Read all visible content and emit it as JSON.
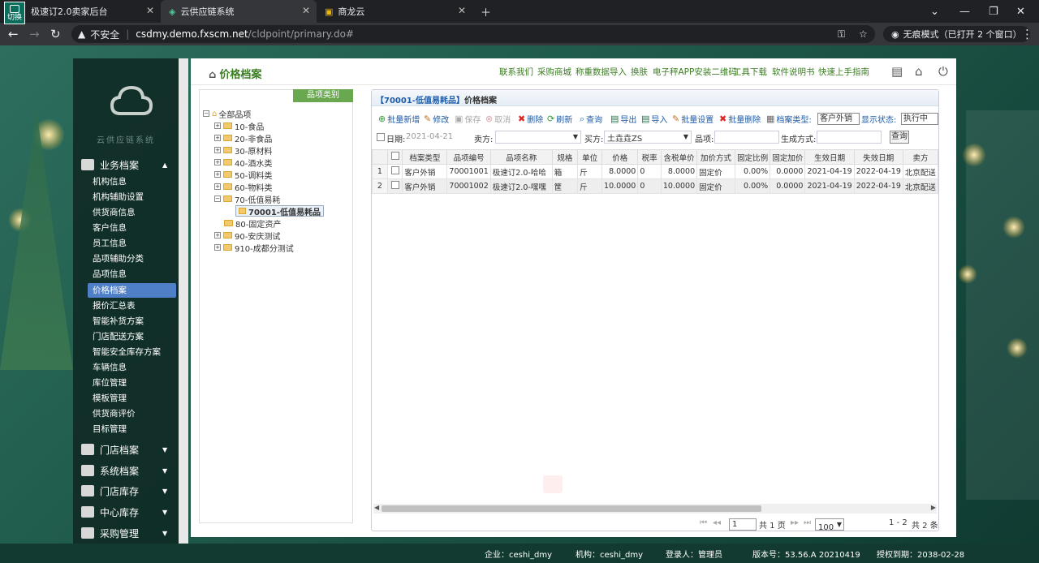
{
  "browser": {
    "switch_label": "切换",
    "tabs": [
      {
        "title": "极速订2.0卖家后台"
      },
      {
        "title": "云供应链系统"
      },
      {
        "title": "商龙云"
      }
    ],
    "insecure_label": "不安全",
    "url_host": "csdmy.demo.fxscm.net",
    "url_path": "/cldpoint/primary.do#",
    "incognito_label": "无痕模式（已打开 2 个窗口）"
  },
  "sidebar": {
    "logo_text": "云供应链系统",
    "groups": [
      {
        "label": "业务档案"
      },
      {
        "label": "门店档案"
      },
      {
        "label": "系统档案"
      },
      {
        "label": "门店库存"
      },
      {
        "label": "中心库存"
      },
      {
        "label": "采购管理"
      }
    ],
    "items": [
      {
        "label": "机构信息"
      },
      {
        "label": "机构辅助设置"
      },
      {
        "label": "供货商信息"
      },
      {
        "label": "客户信息"
      },
      {
        "label": "员工信息"
      },
      {
        "label": "品项辅助分类"
      },
      {
        "label": "品项信息"
      },
      {
        "label": "价格档案"
      },
      {
        "label": "报价汇总表"
      },
      {
        "label": "智能补货方案"
      },
      {
        "label": "门店配送方案"
      },
      {
        "label": "智能安全库存方案"
      },
      {
        "label": "车辆信息"
      },
      {
        "label": "库位管理"
      },
      {
        "label": "模板管理"
      },
      {
        "label": "供货商评价"
      },
      {
        "label": "目标管理"
      }
    ]
  },
  "header": {
    "title": "价格档案",
    "links": [
      "联系我们",
      "采购商城",
      "称重数据导入",
      "换肤",
      "电子秤APP安装二维码",
      "工具下载",
      "软件说明书",
      "快速上手指南"
    ]
  },
  "category": {
    "heading": "品项类别",
    "root": "全部品项",
    "nodes": [
      "10-食品",
      "20-非食品",
      "30-原材料",
      "40-酒水类",
      "50-调料类",
      "60-物料类",
      "70-低值易耗",
      "70001-低值易耗品",
      "80-固定资产",
      "90-安庆测试",
      "910-成都分测试"
    ]
  },
  "grid": {
    "category_tag": "【70001-低值易耗品】",
    "title": "价格档案",
    "toolbar": {
      "batch_add": "批量新增",
      "edit": "修改",
      "save": "保存",
      "cancel": "取消",
      "delete": "删除",
      "refresh": "刷新",
      "query": "查询",
      "export": "导出",
      "import": "导入",
      "batch_set": "批量设置",
      "batch_delete": "批量删除",
      "archive_type_label": "档案类型:",
      "archive_type_value": "客户外销",
      "display_status_label": "显示状态:",
      "display_status_value": "执行中"
    },
    "filters": {
      "date_label": "日期:",
      "date_value": "2021-04-21",
      "seller_label": "卖方:",
      "buyer_label": "买方:",
      "buyer_value": "土垚垚ZS",
      "item_label": "品项:",
      "gen_label": "生成方式:",
      "query_button": "查询"
    },
    "columns": [
      "档案类型",
      "品项编号",
      "品项名称",
      "规格",
      "单位",
      "价格",
      "税率",
      "含税单价",
      "加价方式",
      "固定比例",
      "固定加价",
      "生效日期",
      "失效日期",
      "卖方"
    ],
    "rows": [
      {
        "num": "1",
        "type": "客户外销",
        "code": "70001001",
        "name": "极速订2.0-哈哈",
        "spec": "箱",
        "unit": "斤",
        "price": "8.0000",
        "tax": "0",
        "taxprice": "8.0000",
        "method": "固定价",
        "ratio": "0.00%",
        "fixed": "0.0000",
        "start": "2021-04-19",
        "end": "2022-04-19",
        "seller": "北京配送"
      },
      {
        "num": "2",
        "type": "客户外销",
        "code": "70001002",
        "name": "极速订2.0-嘿嘿",
        "spec": "筐",
        "unit": "斤",
        "price": "10.0000",
        "tax": "0",
        "taxprice": "10.0000",
        "method": "固定价",
        "ratio": "0.00%",
        "fixed": "0.0000",
        "start": "2021-04-19",
        "end": "2022-04-19",
        "seller": "北京配送"
      }
    ],
    "pager": {
      "page": "1",
      "total_pages": "共 1 页",
      "page_size": "100",
      "range": "1 - 2",
      "total": "共 2 条"
    }
  },
  "statusbar": {
    "company": "企业：ceshi_dmy",
    "org": "机构：ceshi_dmy",
    "user": "登录人：管理员",
    "version": "版本号：53.56.A 20210419",
    "license": "授权到期：2038-02-28"
  }
}
